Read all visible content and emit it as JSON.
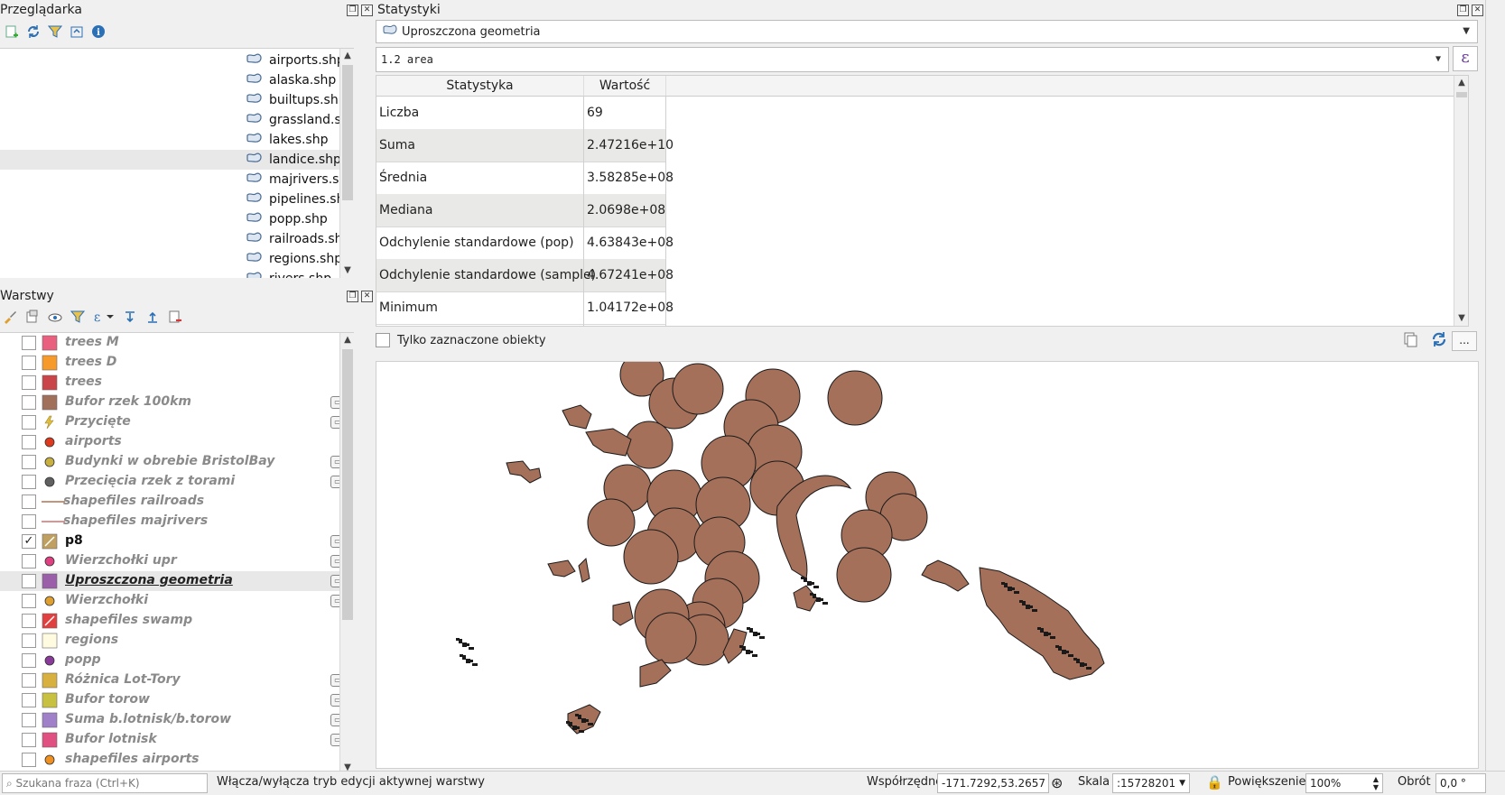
{
  "browser": {
    "title": "Przeglądarka",
    "items": [
      "airports.shp",
      "alaska.shp",
      "builtups.shp",
      "grassland.shp",
      "lakes.shp",
      "landice.shp",
      "majrivers.shp",
      "pipelines.shp",
      "popp.shp",
      "railroads.shp",
      "regions.shp",
      "rivers.shp"
    ],
    "selected_index": 5
  },
  "layers": {
    "title": "Warstwy",
    "items": [
      {
        "name": "trees M",
        "checked": false,
        "symbol": "fill",
        "color": "#e8607e",
        "edit": false
      },
      {
        "name": "trees D",
        "checked": false,
        "symbol": "fill",
        "color": "#f79a2c",
        "edit": false
      },
      {
        "name": "trees",
        "checked": false,
        "symbol": "fill",
        "color": "#c9454a",
        "edit": false
      },
      {
        "name": "Bufor rzek 100km",
        "checked": false,
        "symbol": "fill",
        "color": "#a0705a",
        "edit": true
      },
      {
        "name": "Przycięte",
        "checked": false,
        "symbol": "mixed",
        "color": "#e0c040",
        "edit": true
      },
      {
        "name": "airports",
        "checked": false,
        "symbol": "point",
        "color": "#e03a1e",
        "edit": false
      },
      {
        "name": "Budynki w obrebie BristolBay",
        "checked": false,
        "symbol": "point",
        "color": "#c8b040",
        "edit": true
      },
      {
        "name": "Przecięcia rzek z torami",
        "checked": false,
        "symbol": "point",
        "color": "#606060",
        "edit": true
      },
      {
        "name": "shapefiles railroads",
        "checked": false,
        "symbol": "line",
        "color": "#b07050",
        "edit": false
      },
      {
        "name": "shapefiles majrivers",
        "checked": false,
        "symbol": "line",
        "color": "#d07070",
        "edit": false
      },
      {
        "name": "p8",
        "checked": true,
        "symbol": "raster",
        "color": "#c0a060",
        "edit": true
      },
      {
        "name": "Wierzchołki upr",
        "checked": false,
        "symbol": "point",
        "color": "#e04080",
        "edit": true
      },
      {
        "name": "Uproszczona geometria",
        "checked": false,
        "symbol": "fill",
        "color": "#9a5fa8",
        "edit": true
      },
      {
        "name": "Wierzchołki",
        "checked": false,
        "symbol": "point",
        "color": "#e0a030",
        "edit": true
      },
      {
        "name": "shapefiles swamp",
        "checked": false,
        "symbol": "raster",
        "color": "#e04040",
        "edit": false
      },
      {
        "name": "regions",
        "checked": false,
        "symbol": "fill",
        "color": "#fffbe0",
        "edit": false
      },
      {
        "name": "popp",
        "checked": false,
        "symbol": "point",
        "color": "#8a3a9a",
        "edit": false
      },
      {
        "name": "Różnica Lot-Tory",
        "checked": false,
        "symbol": "fill",
        "color": "#d8b040",
        "edit": true
      },
      {
        "name": "Bufor torow",
        "checked": false,
        "symbol": "fill",
        "color": "#c8c040",
        "edit": true
      },
      {
        "name": "Suma b.lotnisk/b.torow",
        "checked": false,
        "symbol": "fill",
        "color": "#a080c8",
        "edit": true
      },
      {
        "name": "Bufor lotnisk",
        "checked": false,
        "symbol": "fill",
        "color": "#e05080",
        "edit": true
      },
      {
        "name": "shapefiles airports",
        "checked": false,
        "symbol": "point",
        "color": "#f09020",
        "edit": false
      }
    ],
    "active_index": 10,
    "current_index": 12
  },
  "stats": {
    "title": "Statystyki",
    "layer": "Uproszczona geometria",
    "field": "1.2 area",
    "epsilon": "ε",
    "headers": [
      "Statystyka",
      "Wartość"
    ],
    "rows": [
      [
        "Liczba",
        "69"
      ],
      [
        "Suma",
        "2.47216e+10"
      ],
      [
        "Średnia",
        "3.58285e+08"
      ],
      [
        "Mediana",
        "2.0698e+08"
      ],
      [
        "Odchylenie standardowe (pop)",
        "4.63843e+08"
      ],
      [
        "Odchylenie standardowe (sample)",
        "4.67241e+08"
      ],
      [
        "Minimum",
        "1.04172e+08"
      ]
    ],
    "only_selected": "Tylko zaznaczone obiekty",
    "more": "..."
  },
  "status": {
    "search_placeholder": "Szukana fraza (Ctrl+K)",
    "message": "Włącza/wyłącza tryb edycji aktywnej warstwy",
    "coords_label": "Współrzędne",
    "coords": "-171.7292,53.2657",
    "scale_label": "Skala",
    "scale": ":15728201",
    "magnifier_label": "Powiększenie",
    "magnifier": "100%",
    "rotation_label": "Obrót",
    "rotation": "0,0 °"
  },
  "colors": {
    "feature_fill": "#a5705a",
    "feature_stroke": "#1a1a1a",
    "accent": "#2b6fb5"
  }
}
